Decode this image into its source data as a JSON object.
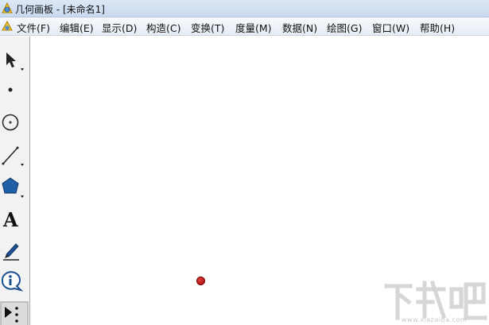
{
  "window": {
    "title": "几何画板 - [未命名1]"
  },
  "menu": [
    "文件(F)",
    "编辑(E)",
    "显示(D)",
    "构造(C)",
    "变换(T)",
    "度量(M)",
    "数据(N)",
    "绘图(G)",
    "窗口(W)",
    "帮助(H)"
  ],
  "toolbox": [
    {
      "name": "selection-arrow-tool",
      "icon": "arrow-icon"
    },
    {
      "name": "point-tool",
      "icon": "point-icon"
    },
    {
      "name": "compass-tool",
      "icon": "circle-icon"
    },
    {
      "name": "straightedge-tool",
      "icon": "line-icon"
    },
    {
      "name": "polygon-tool",
      "icon": "pentagon-icon"
    },
    {
      "name": "text-tool",
      "icon": "text-a-icon",
      "glyph": "A"
    },
    {
      "name": "marker-tool",
      "icon": "pen-icon"
    },
    {
      "name": "information-tool",
      "icon": "info-icon"
    },
    {
      "name": "custom-tool",
      "icon": "play-dots-icon"
    }
  ],
  "canvas": {
    "point_color": "#b31414"
  },
  "watermark": {
    "brand": "下载吧",
    "url": "www.xiazaiba.com"
  },
  "colors": {
    "titlebar": "#c9daf0",
    "menubar": "#eef2f7",
    "toolbox": "#f2f2f2",
    "canvas": "#ffffff"
  }
}
